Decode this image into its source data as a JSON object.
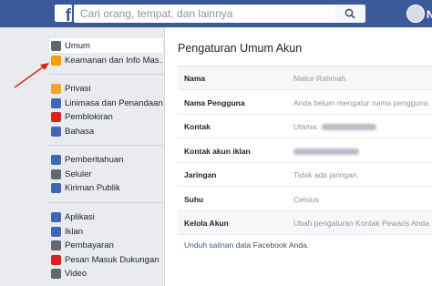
{
  "header": {
    "logo_letter": "f",
    "search_placeholder": "Cari orang, tempat, dan lainnya",
    "user_initial": "N",
    "brand_color": "#3b5998"
  },
  "sidebar": {
    "groups": [
      [
        {
          "label": "Umum",
          "icon": "gear-icon",
          "color": "#606770",
          "active": true
        },
        {
          "label": "Keamanan dan Info Mas…",
          "icon": "shield-icon",
          "color": "#f0a000"
        }
      ],
      [
        {
          "label": "Privasi",
          "icon": "lock-icon",
          "color": "#f5a623"
        },
        {
          "label": "Linimasa dan Penandaan",
          "icon": "timeline-icon",
          "color": "#4267b2"
        },
        {
          "label": "Pemblokiran",
          "icon": "block-icon",
          "color": "#e02020"
        },
        {
          "label": "Bahasa",
          "icon": "language-icon",
          "color": "#4267b2"
        }
      ],
      [
        {
          "label": "Pemberitahuan",
          "icon": "globe-icon",
          "color": "#4267b2"
        },
        {
          "label": "Seluler",
          "icon": "mobile-icon",
          "color": "#606770"
        },
        {
          "label": "Kiriman Publik",
          "icon": "rss-icon",
          "color": "#4267b2"
        }
      ],
      [
        {
          "label": "Aplikasi",
          "icon": "apps-icon",
          "color": "#4267b2"
        },
        {
          "label": "Iklan",
          "icon": "ads-icon",
          "color": "#4267b2"
        },
        {
          "label": "Pembayaran",
          "icon": "card-icon",
          "color": "#606770"
        },
        {
          "label": "Pesan Masuk Dukungan",
          "icon": "lifebuoy-icon",
          "color": "#e02020"
        },
        {
          "label": "Video",
          "icon": "video-icon",
          "color": "#606770"
        }
      ]
    ]
  },
  "main": {
    "title": "Pengaturan Umum Akun",
    "rows": [
      {
        "label": "Nama",
        "value": "Niatur Rahmah",
        "shaded": true
      },
      {
        "label": "Nama Pengguna",
        "value": "Anda belum mengatur nama pengguna."
      },
      {
        "label": "Kontak",
        "value": "Utama:",
        "blurred": true
      },
      {
        "label": "Kontak akun iklan",
        "value": "",
        "blurred": true
      },
      {
        "label": "Jaringan",
        "value": "Tidak ada jaringan."
      },
      {
        "label": "Suhu",
        "value": "Celsius"
      },
      {
        "label": "Kelola Akun",
        "value": "Ubah pengaturan Kontak Pewaris Anda",
        "shaded": true
      }
    ],
    "footer_link": "Unduh salinan",
    "footer_text": " data Facebook Anda."
  },
  "annotation": {
    "arrow_color": "#e02020"
  }
}
